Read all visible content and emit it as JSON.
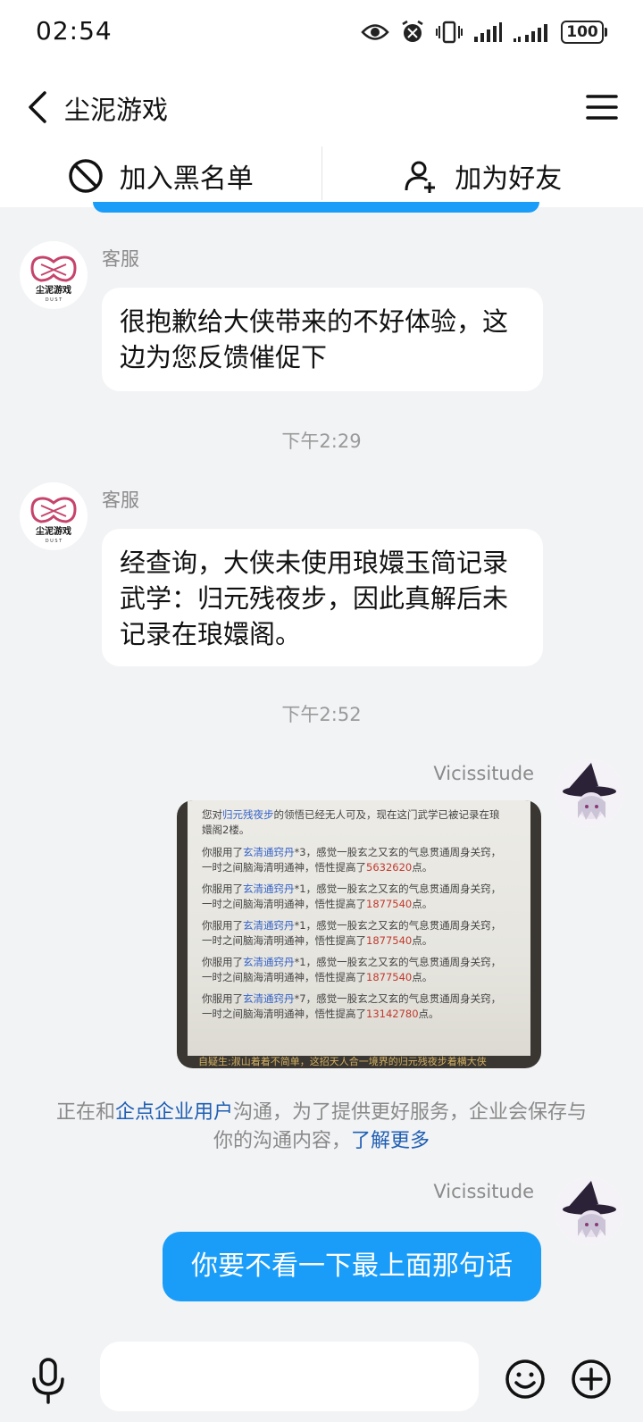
{
  "status": {
    "time": "02:54",
    "battery": "100"
  },
  "header": {
    "title": "尘泥游戏"
  },
  "actions": {
    "blacklist": "加入黑名单",
    "add_friend": "加为好友"
  },
  "messages": [
    {
      "sender": "客服",
      "text": "很抱歉给大侠带来的不好体验，这边为您反馈催促下"
    },
    {
      "sender": "客服",
      "text": "经查询，大侠未使用琅嬛玉简记录武学：归元残夜步，因此真解后未记录在琅嬛阁。"
    },
    {
      "sender": "Vicissitude"
    },
    {
      "sender": "Vicissitude",
      "text": "你要不看一下最上面那句话"
    }
  ],
  "timestamps": [
    "下午2:29",
    "下午2:52"
  ],
  "avatar_logo": {
    "line1": "尘泥游戏",
    "line2": "D U S T"
  },
  "screenshot": {
    "line1_pre": "您对",
    "line1_skill": "归元残夜步",
    "line1_post": "的领悟已经无人可及，现在这门武学已被记录在琅",
    "line2": "嬛阁2楼。",
    "entries": [
      {
        "pre": "你服用了",
        "item": "玄清通窍丹",
        "count": "*3",
        "mid": "，感觉一股玄之又玄的气息贯通周身关窍，",
        "line2_pre": "一时之间脑海清明通神，悟性提高了",
        "value": "5632620",
        "unit": "点。"
      },
      {
        "pre": "你服用了",
        "item": "玄清通窍丹",
        "count": "*1",
        "mid": "，感觉一股玄之又玄的气息贯通周身关窍，",
        "line2_pre": "一时之间脑海清明通神，悟性提高了",
        "value": "1877540",
        "unit": "点。"
      },
      {
        "pre": "你服用了",
        "item": "玄清通窍丹",
        "count": "*1",
        "mid": "，感觉一股玄之又玄的气息贯通周身关窍，",
        "line2_pre": "一时之间脑海清明通神，悟性提高了",
        "value": "1877540",
        "unit": "点。"
      },
      {
        "pre": "你服用了",
        "item": "玄清通窍丹",
        "count": "*1",
        "mid": "，感觉一股玄之又玄的气息贯通周身关窍，",
        "line2_pre": "一时之间脑海清明通神，悟性提高了",
        "value": "1877540",
        "unit": "点。"
      },
      {
        "pre": "你服用了",
        "item": "玄清通窍丹",
        "count": "*7",
        "mid": "，感觉一股玄之又玄的气息贯通周身关窍，",
        "line2_pre": "一时之间脑海清明通神，悟性提高了",
        "value": "13142780",
        "unit": "点。"
      }
    ],
    "bottom": "自疑生:淑山着着不简单，这招天人合一境界的归元残夜步着横大侠"
  },
  "notice": {
    "pre": "正在和",
    "link1": "企点企业用户",
    "mid": "沟通，为了提供更好服务，企业会保存与",
    "line2": "你的沟通内容，",
    "link2": "了解更多"
  },
  "colors": {
    "accent": "#1a9df8",
    "background": "#f2f3f5",
    "link": "#1f5fb3",
    "logo": "#c6446b"
  }
}
